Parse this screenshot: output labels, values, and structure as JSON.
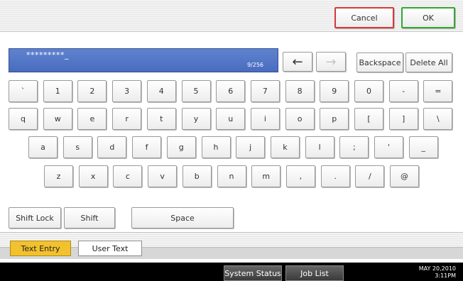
{
  "header": {
    "cancel_label": "Cancel",
    "ok_label": "OK"
  },
  "entry": {
    "value": "*********_",
    "counter": "9/256"
  },
  "edit": {
    "left_arrow": "←",
    "right_arrow": "→",
    "backspace_label": "Backspace",
    "delete_all_label": "Delete All"
  },
  "keyboard": {
    "row1": [
      "`",
      "1",
      "2",
      "3",
      "4",
      "5",
      "6",
      "7",
      "8",
      "9",
      "0",
      "-",
      "="
    ],
    "row2": [
      "q",
      "w",
      "e",
      "r",
      "t",
      "y",
      "u",
      "i",
      "o",
      "p",
      "[",
      "]",
      "\\"
    ],
    "row3": [
      "a",
      "s",
      "d",
      "f",
      "g",
      "h",
      "j",
      "k",
      "l",
      ";",
      "'",
      "_"
    ],
    "row4": [
      "z",
      "x",
      "c",
      "v",
      "b",
      "n",
      "m",
      ",",
      ".",
      "/",
      "@"
    ]
  },
  "modifiers": {
    "shift_lock": "Shift Lock",
    "shift": "Shift",
    "space": "Space"
  },
  "tabs": [
    {
      "label": "Text Entry",
      "active": true
    },
    {
      "label": "User Text",
      "active": false
    }
  ],
  "statusbar": {
    "system_status": "System Status",
    "job_list": "Job List",
    "date": "MAY   20,2010",
    "time": "3:11PM"
  },
  "colors": {
    "entry_bg": "#4a6cbf",
    "active_tab": "#f2c12e",
    "cancel_border": "#d23a3a",
    "ok_border": "#33a633"
  }
}
